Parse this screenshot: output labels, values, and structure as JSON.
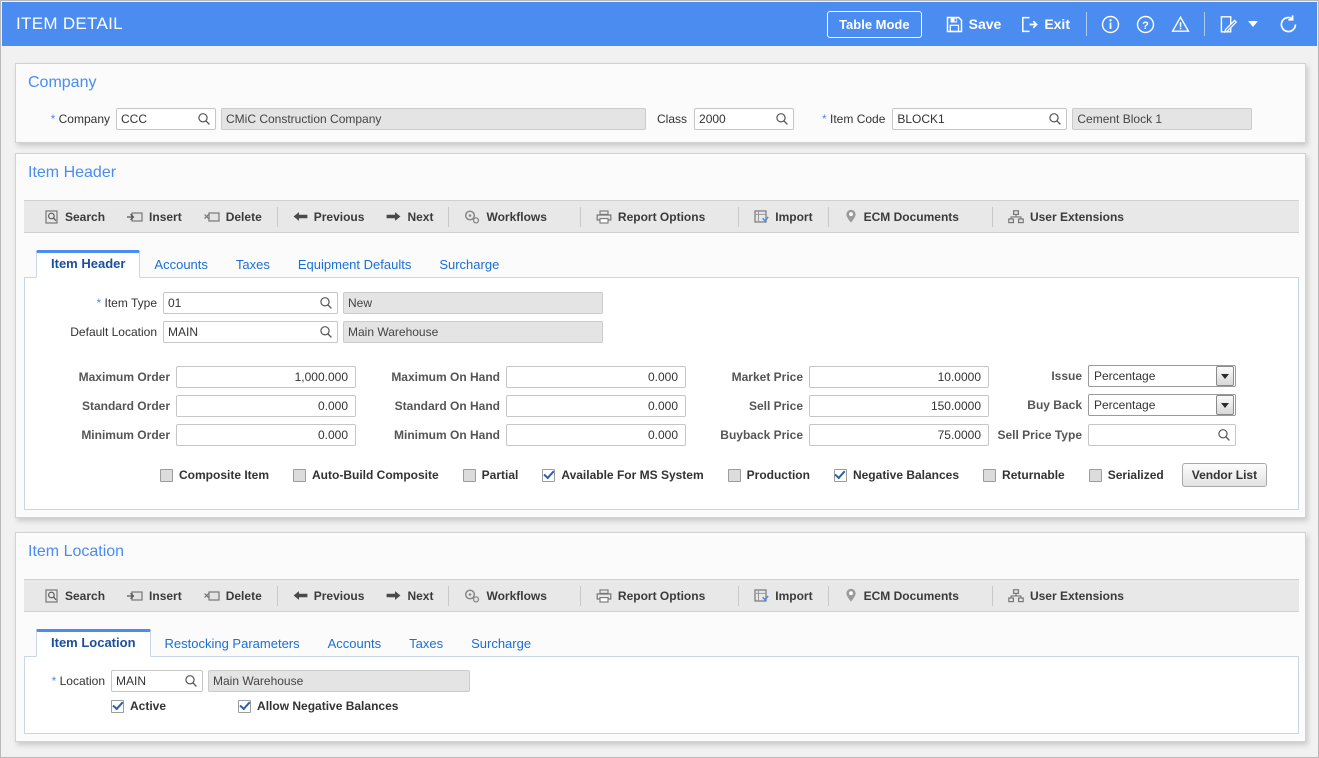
{
  "window": {
    "title": "ITEM DETAIL",
    "accent_color": "#4a8cf0",
    "toolbar": {
      "table_mode": "Table Mode",
      "save": "Save",
      "exit": "Exit",
      "icons": [
        "info-icon",
        "help-icon",
        "warning-icon",
        "notes-icon",
        "chevron-down-icon",
        "refresh-icon"
      ]
    }
  },
  "company_panel": {
    "title": "Company",
    "company_label": "Company",
    "company_required": "*",
    "company_code": "CCC",
    "company_name": "CMiC Construction Company",
    "class_label": "Class",
    "class_value": "2000",
    "item_code_label": "Item Code",
    "item_code_required": "*",
    "item_code_value": "BLOCK1",
    "item_description": "Cement Block 1"
  },
  "item_header_panel": {
    "title": "Item Header",
    "actions": [
      {
        "label": "Search",
        "icon": "search-icon"
      },
      {
        "label": "Insert",
        "icon": "insert-icon"
      },
      {
        "label": "Delete",
        "icon": "delete-icon"
      },
      {
        "label": "Previous",
        "icon": "arrow-left-icon"
      },
      {
        "label": "Next",
        "icon": "arrow-right-icon"
      },
      {
        "label": "Workflows",
        "icon": "workflows-icon"
      },
      {
        "label": "Report Options",
        "icon": "printer-icon"
      },
      {
        "label": "Import",
        "icon": "import-icon"
      },
      {
        "label": "ECM Documents",
        "icon": "ecm-icon"
      },
      {
        "label": "User Extensions",
        "icon": "user-extensions-icon"
      }
    ],
    "tabs": [
      {
        "label": "Item Header",
        "active": true
      },
      {
        "label": "Accounts",
        "active": false
      },
      {
        "label": "Taxes",
        "active": false
      },
      {
        "label": "Equipment Defaults",
        "active": false
      },
      {
        "label": "Surcharge",
        "active": false
      }
    ],
    "item_type_label": "Item Type",
    "item_type_required": "*",
    "item_type_value": "01",
    "item_type_desc": "New",
    "default_location_label": "Default Location",
    "default_location_value": "MAIN",
    "default_location_desc": "Main Warehouse",
    "col1": [
      {
        "label": "Maximum Order",
        "value": "1,000.000"
      },
      {
        "label": "Standard Order",
        "value": "0.000"
      },
      {
        "label": "Minimum Order",
        "value": "0.000"
      }
    ],
    "col2": [
      {
        "label": "Maximum On Hand",
        "value": "0.000"
      },
      {
        "label": "Standard On Hand",
        "value": "0.000"
      },
      {
        "label": "Minimum On Hand",
        "value": "0.000"
      }
    ],
    "col3": [
      {
        "label": "Market Price",
        "value": "10.0000"
      },
      {
        "label": "Sell Price",
        "value": "150.0000"
      },
      {
        "label": "Buyback Price",
        "value": "75.0000"
      }
    ],
    "issue_label": "Issue",
    "issue_value": "Percentage",
    "buy_back_label": "Buy Back",
    "buy_back_value": "Percentage",
    "sell_price_type_label": "Sell Price Type",
    "sell_price_type_value": "",
    "checkboxes": [
      {
        "label": "Composite Item",
        "checked": false
      },
      {
        "label": "Auto-Build Composite",
        "checked": false
      },
      {
        "label": "Partial",
        "checked": false
      },
      {
        "label": "Available For MS System",
        "checked": true
      },
      {
        "label": "Production",
        "checked": false
      },
      {
        "label": "Negative Balances",
        "checked": true
      },
      {
        "label": "Returnable",
        "checked": false
      },
      {
        "label": "Serialized",
        "checked": false
      }
    ],
    "vendor_list_button": "Vendor List"
  },
  "item_location_panel": {
    "title": "Item Location",
    "actions": [
      {
        "label": "Search",
        "icon": "search-icon"
      },
      {
        "label": "Insert",
        "icon": "insert-icon"
      },
      {
        "label": "Delete",
        "icon": "delete-icon"
      },
      {
        "label": "Previous",
        "icon": "arrow-left-icon"
      },
      {
        "label": "Next",
        "icon": "arrow-right-icon"
      },
      {
        "label": "Workflows",
        "icon": "workflows-icon"
      },
      {
        "label": "Report Options",
        "icon": "printer-icon"
      },
      {
        "label": "Import",
        "icon": "import-icon"
      },
      {
        "label": "ECM Documents",
        "icon": "ecm-icon"
      },
      {
        "label": "User Extensions",
        "icon": "user-extensions-icon"
      }
    ],
    "tabs": [
      {
        "label": "Item Location",
        "active": true
      },
      {
        "label": "Restocking Parameters",
        "active": false
      },
      {
        "label": "Accounts",
        "active": false
      },
      {
        "label": "Taxes",
        "active": false
      },
      {
        "label": "Surcharge",
        "active": false
      }
    ],
    "location_label": "Location",
    "location_required": "*",
    "location_value": "MAIN",
    "location_desc": "Main Warehouse",
    "checkboxes": [
      {
        "label": "Active",
        "checked": true
      },
      {
        "label": "Allow Negative Balances",
        "checked": true
      }
    ]
  }
}
